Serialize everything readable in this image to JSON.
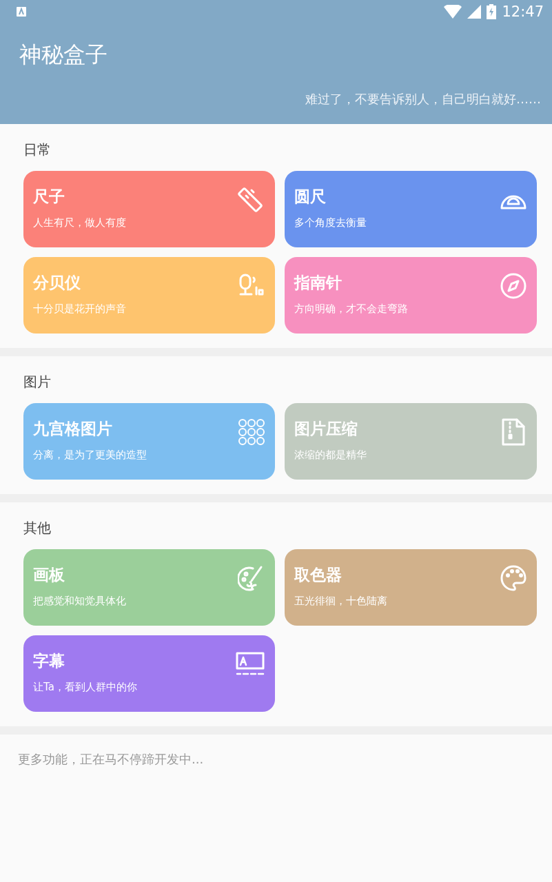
{
  "status_bar": {
    "time": "12:47"
  },
  "header": {
    "title": "神秘盒子",
    "subtitle": "难过了，不要告诉别人，自己明白就好……"
  },
  "sections": [
    {
      "title": "日常",
      "items": [
        {
          "title": "尺子",
          "subtitle": "人生有尺，做人有度",
          "color": "#fb8179"
        },
        {
          "title": "圆尺",
          "subtitle": "多个角度去衡量",
          "color": "#6a93ee"
        },
        {
          "title": "分贝仪",
          "subtitle": "十分贝是花开的声音",
          "color": "#fec46e"
        },
        {
          "title": "指南针",
          "subtitle": "方向明确，才不会走弯路",
          "color": "#f790bf"
        }
      ]
    },
    {
      "title": "图片",
      "items": [
        {
          "title": "九宫格图片",
          "subtitle": "分离，是为了更美的造型",
          "color": "#7dbef0"
        },
        {
          "title": "图片压缩",
          "subtitle": "浓缩的都是精华",
          "color": "#c1cbc0"
        }
      ]
    },
    {
      "title": "其他",
      "items": [
        {
          "title": "画板",
          "subtitle": "把感觉和知觉具体化",
          "color": "#9bcf9a"
        },
        {
          "title": "取色器",
          "subtitle": "五光徘徊，十色陆离",
          "color": "#d1b18b"
        },
        {
          "title": "字幕",
          "subtitle": "让Ta，看到人群中的你",
          "color": "#9f7af0"
        }
      ]
    }
  ],
  "footer": "更多功能，正在马不停蹄开发中..."
}
